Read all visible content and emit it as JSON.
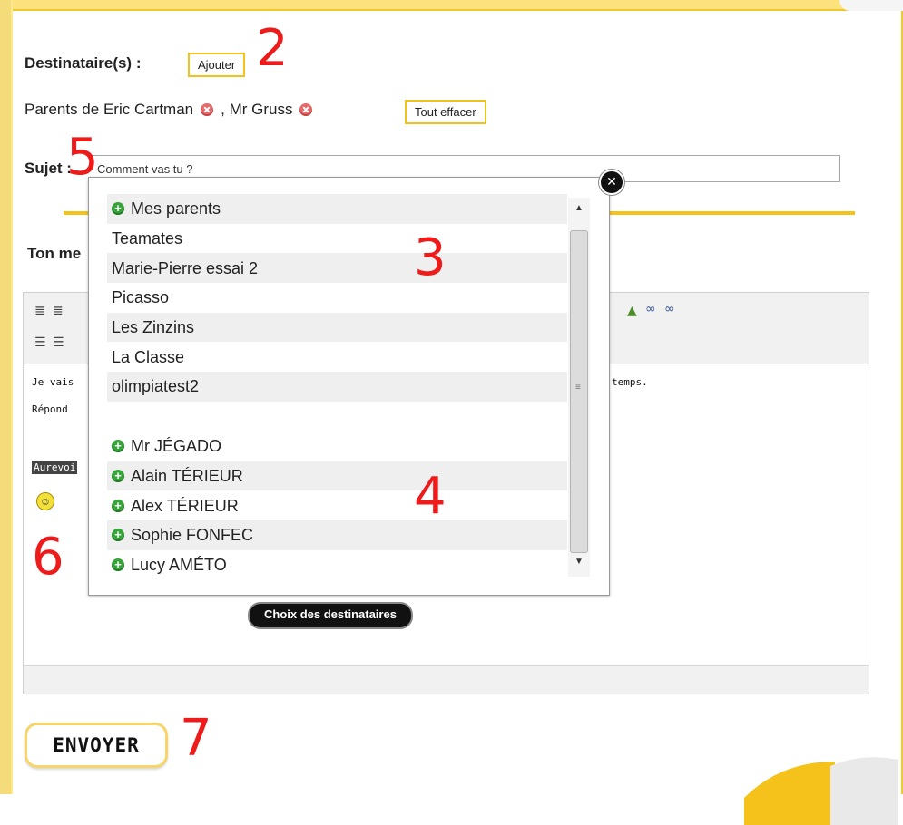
{
  "header": {
    "recipients_label": "Destinataire(s) :",
    "add_button": "Ajouter",
    "selected_recipients": [
      {
        "name": "Parents de Eric Cartman"
      },
      {
        "name": ", Mr Gruss"
      }
    ],
    "clear_all_button": "Tout effacer",
    "subject_label": "Sujet :",
    "subject_value": "Comment vas tu ?",
    "message_label": "Ton me"
  },
  "popup": {
    "close_glyph": "✕",
    "groups": [
      {
        "label": "Mes parents",
        "plus": true
      },
      {
        "label": "Teamates",
        "plus": false
      },
      {
        "label": "Marie-Pierre essai 2",
        "plus": false
      },
      {
        "label": "Picasso",
        "plus": false
      },
      {
        "label": "Les Zinzins",
        "plus": false
      },
      {
        "label": "La Classe",
        "plus": false
      },
      {
        "label": "olimpiatest2",
        "plus": false
      }
    ],
    "people": [
      {
        "label": "Mr JÉGADO"
      },
      {
        "label": "Alain TÉRIEUR"
      },
      {
        "label": "Alex TÉRIEUR"
      },
      {
        "label": "Sophie FONFEC"
      },
      {
        "label": "Lucy AMÉTO"
      }
    ],
    "choose_button": "Choix des destinataires"
  },
  "editor": {
    "line1_start": "Je vais",
    "line1_end": "temps.",
    "line2_start": "Répond",
    "signature": "Aurevoi"
  },
  "annotations": [
    "2",
    "3",
    "4",
    "5",
    "6",
    "7"
  ],
  "send_button": "ENVOYER",
  "colors": {
    "accent_yellow": "#f5c21b",
    "annotation_red": "#ee1b1b",
    "add_green": "#37a43a",
    "remove_red": "#e5686a"
  }
}
